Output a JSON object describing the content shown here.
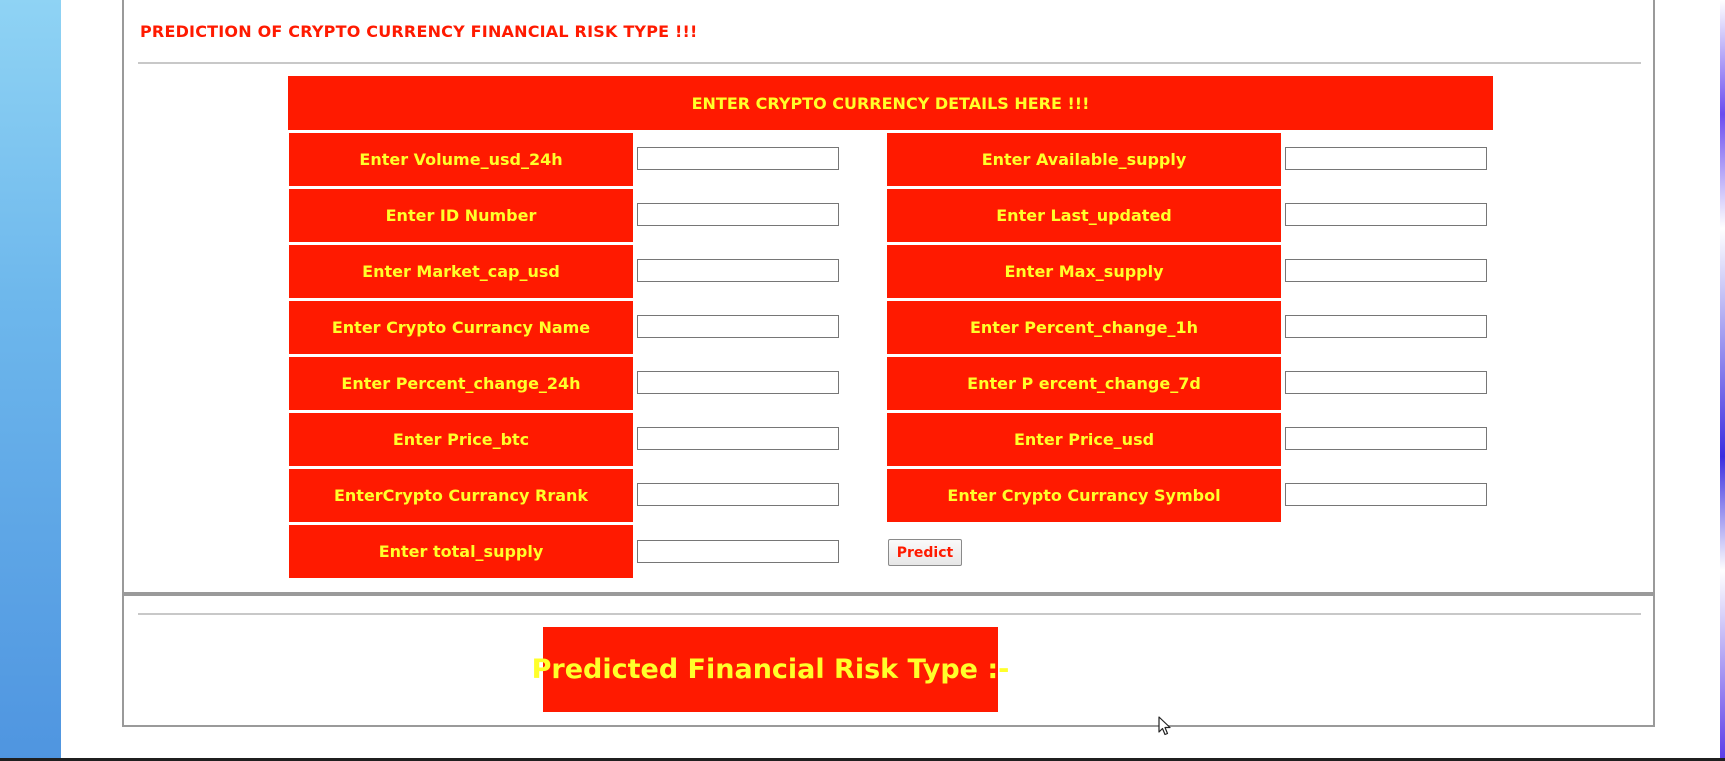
{
  "page": {
    "title": "PREDICTION OF CRYPTO CURRENCY FINANCIAL RISK TYPE !!!"
  },
  "form": {
    "header": "ENTER CRYPTO CURRENCY DETAILS HERE !!!",
    "left_fields": [
      {
        "label": "Enter Volume_usd_24h",
        "value": "",
        "placeholder": ""
      },
      {
        "label": "Enter ID Number",
        "value": "",
        "placeholder": ""
      },
      {
        "label": "Enter Market_cap_usd",
        "value": "",
        "placeholder": ""
      },
      {
        "label": "Enter Crypto Currancy Name",
        "value": "",
        "placeholder": ""
      },
      {
        "label": "Enter Percent_change_24h",
        "value": "",
        "placeholder": ""
      },
      {
        "label": "Enter Price_btc",
        "value": "",
        "placeholder": ""
      },
      {
        "label": "EnterCrypto Currancy Rrank",
        "value": "",
        "placeholder": ""
      },
      {
        "label": "Enter total_supply",
        "value": "",
        "placeholder": ""
      }
    ],
    "right_fields": [
      {
        "label": "Enter Available_supply",
        "value": "",
        "placeholder": ""
      },
      {
        "label": "Enter Last_updated",
        "value": "",
        "placeholder": ""
      },
      {
        "label": "Enter Max_supply",
        "value": "",
        "placeholder": ""
      },
      {
        "label": "Enter Percent_change_1h",
        "value": "",
        "placeholder": ""
      },
      {
        "label": "Enter P ercent_change_7d",
        "value": "",
        "placeholder": ""
      },
      {
        "label": "Enter Price_usd",
        "value": "",
        "placeholder": ""
      },
      {
        "label": "Enter Crypto Currancy Symbol",
        "value": "",
        "placeholder": ""
      }
    ],
    "predict_label": "Predict"
  },
  "result": {
    "label": "Predicted Financial Risk Type :-"
  },
  "colors": {
    "accent_red": "#ff1a00",
    "label_yellow": "#ffff2a"
  },
  "icons": {
    "cursor": "mouse-pointer-icon"
  }
}
